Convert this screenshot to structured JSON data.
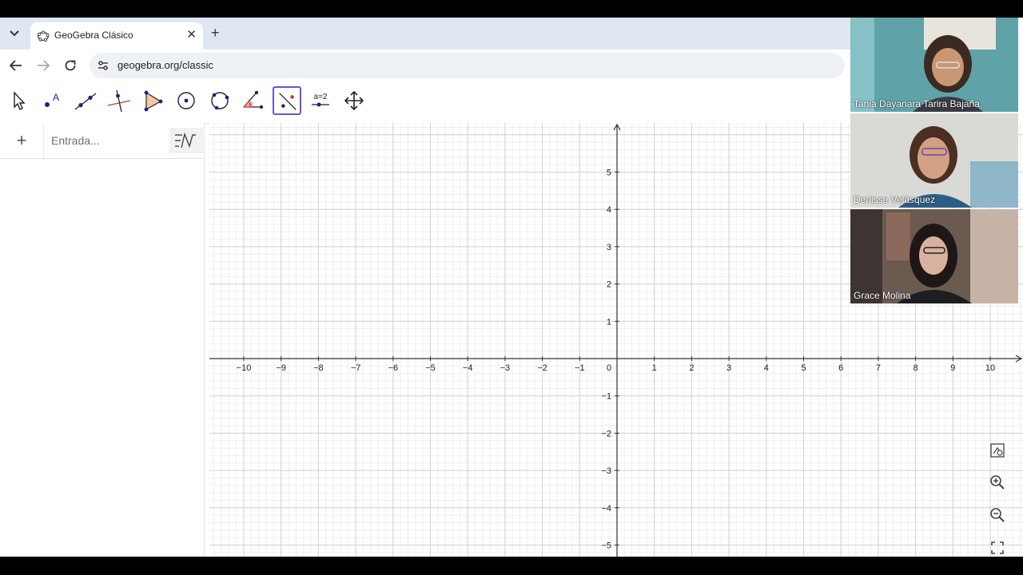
{
  "browser": {
    "tab_title": "GeoGebra Clásico",
    "url": "geogebra.org/classic"
  },
  "algebra": {
    "input_placeholder": "Entrada..."
  },
  "toolbar": {
    "tools": [
      "move-tool",
      "point-tool",
      "line-tool",
      "perpendicular-line-tool",
      "polygon-tool",
      "circle-center-point-tool",
      "circle-three-points-tool",
      "angle-tool",
      "reflect-about-line-tool",
      "slider-tool",
      "move-graphics-view-tool"
    ],
    "active_tool": "reflect-about-line-tool",
    "slider_icon_text": "a=2"
  },
  "graphics": {
    "x_ticks": [
      "−10",
      "−9",
      "−8",
      "−7",
      "−6",
      "−5",
      "−4",
      "−3",
      "−2",
      "−1",
      "0",
      "1",
      "2",
      "3",
      "4",
      "5",
      "6",
      "7",
      "8",
      "9",
      "10"
    ],
    "y_ticks_positive": [
      "1",
      "2",
      "3",
      "4",
      "5"
    ],
    "y_ticks_negative": [
      "−1",
      "−2",
      "−3",
      "−4",
      "−5"
    ],
    "grid": true
  },
  "participants": [
    {
      "name": "Tania Dayanara Tarira Bajaña",
      "bg": "#5fa3a8"
    },
    {
      "name": "Denisse Velásquez",
      "bg": "#d9d9d6"
    },
    {
      "name": "Grace Molina",
      "bg": "#6b5a50"
    }
  ],
  "colors": {
    "accent": "#6557d2",
    "tool_icon": "#1a237e"
  }
}
